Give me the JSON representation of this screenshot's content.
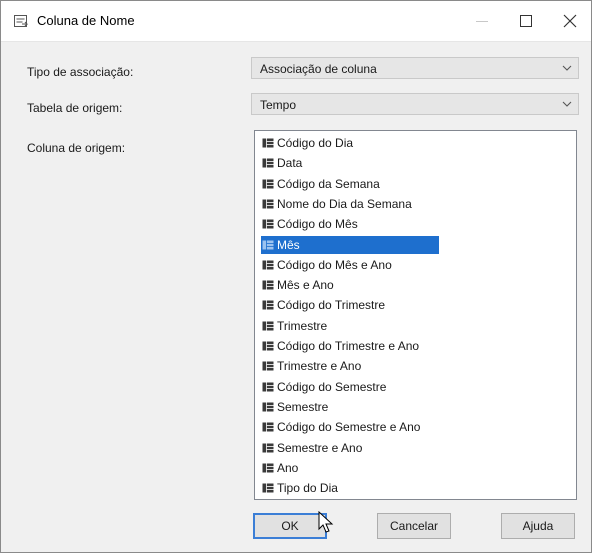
{
  "window": {
    "title": "Coluna de Nome"
  },
  "form": {
    "association_type": {
      "label": "Tipo de associação:",
      "value": "Associação de coluna"
    },
    "source_table": {
      "label": "Tabela de origem:",
      "value": "Tempo"
    },
    "source_column": {
      "label": "Coluna de origem:",
      "items": [
        "Código do Dia",
        "Data",
        "Código da Semana",
        "Nome do Dia da Semana",
        "Código do Mês",
        "Mês",
        "Código do Mês e Ano",
        "Mês e Ano",
        "Código do Trimestre",
        "Trimestre",
        "Código do Trimestre e Ano",
        "Trimestre e Ano",
        "Código do Semestre",
        "Semestre",
        "Código do Semestre e Ano",
        "Semestre e Ano",
        "Ano",
        "Tipo do Dia"
      ],
      "selected": "Mês"
    }
  },
  "buttons": {
    "ok": "OK",
    "cancel": "Cancelar",
    "help": "Ajuda"
  },
  "colors": {
    "selection": "#1e6fce",
    "default_button_border": "#3b7ed6"
  }
}
